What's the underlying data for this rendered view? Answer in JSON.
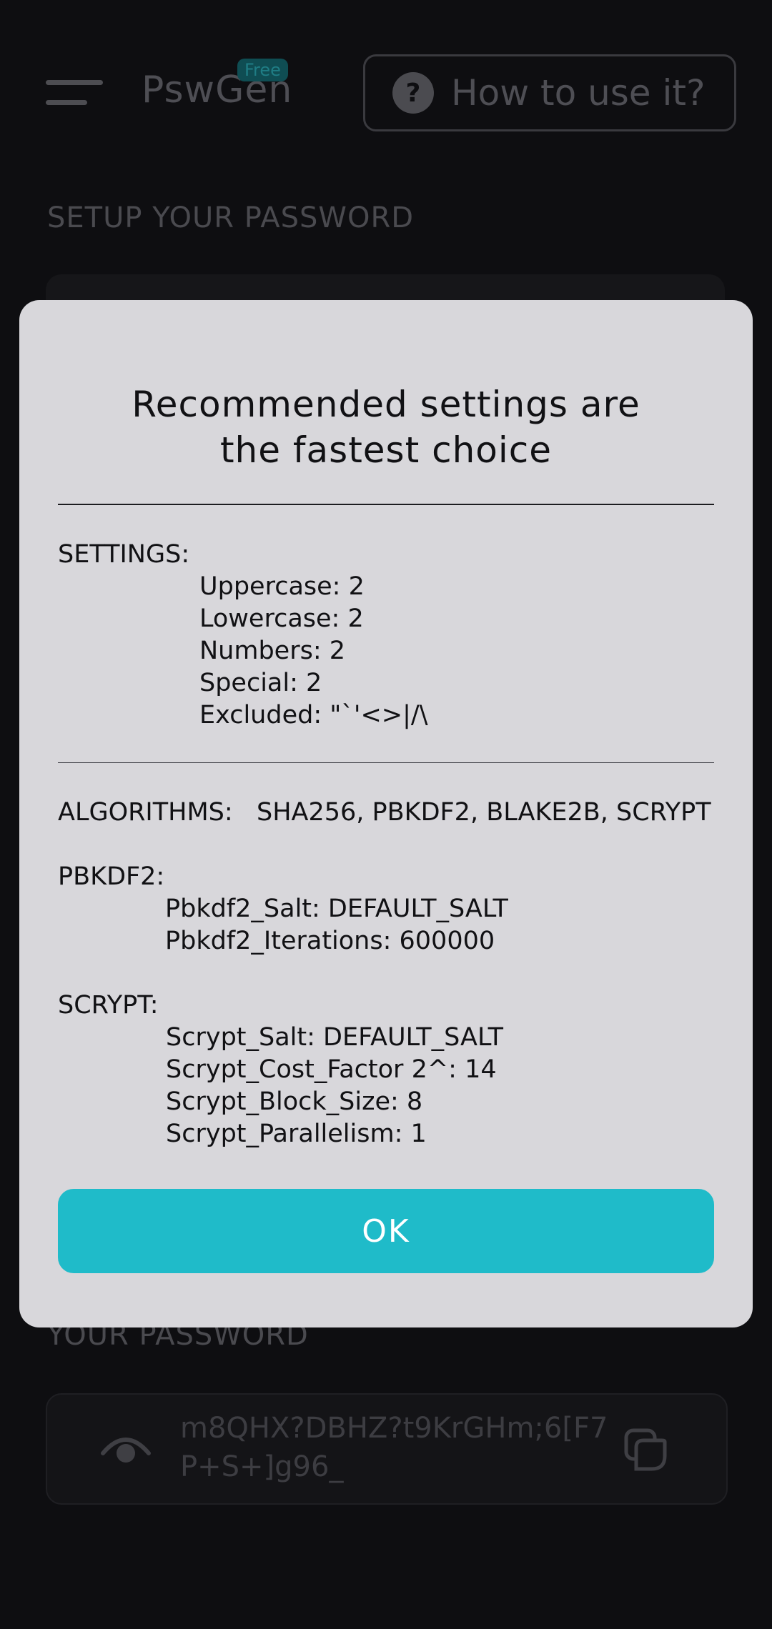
{
  "header": {
    "brand": "PswGen",
    "badge": "Free",
    "help_label": "How to use it?"
  },
  "sections": {
    "setup_label": "SETUP YOUR PASSWORD",
    "password_label": "YOUR PASSWORD"
  },
  "password": {
    "value": "m8QHX?DBHZ?t9KrGHm;6[F7P+S+]g96_"
  },
  "dialog": {
    "title_line1": "Recommended settings are",
    "title_line2": "the fastest choice",
    "settings_heading": "SETTINGS:",
    "settings": [
      "Uppercase: 2",
      "Lowercase: 2",
      "Numbers: 2",
      "Special: 2",
      "Excluded: \"`'<>|/\\"
    ],
    "algorithms_heading": "ALGORITHMS:",
    "algorithms_value": "SHA256, PBKDF2, BLAKE2B, SCRYPT",
    "pbkdf2_heading": "PBKDF2:",
    "pbkdf2": [
      "Pbkdf2_Salt: DEFAULT_SALT",
      "Pbkdf2_Iterations: 600000"
    ],
    "scrypt_heading": "SCRYPT:",
    "scrypt": [
      "Scrypt_Salt: DEFAULT_SALT",
      "Scrypt_Cost_Factor 2^: 14",
      "Scrypt_Block_Size: 8",
      "Scrypt_Parallelism: 1"
    ],
    "ok_label": "OK"
  },
  "colors": {
    "accent": "#1fbbc9",
    "dialog_bg": "#d8d7db",
    "app_bg": "#0e0e11"
  }
}
